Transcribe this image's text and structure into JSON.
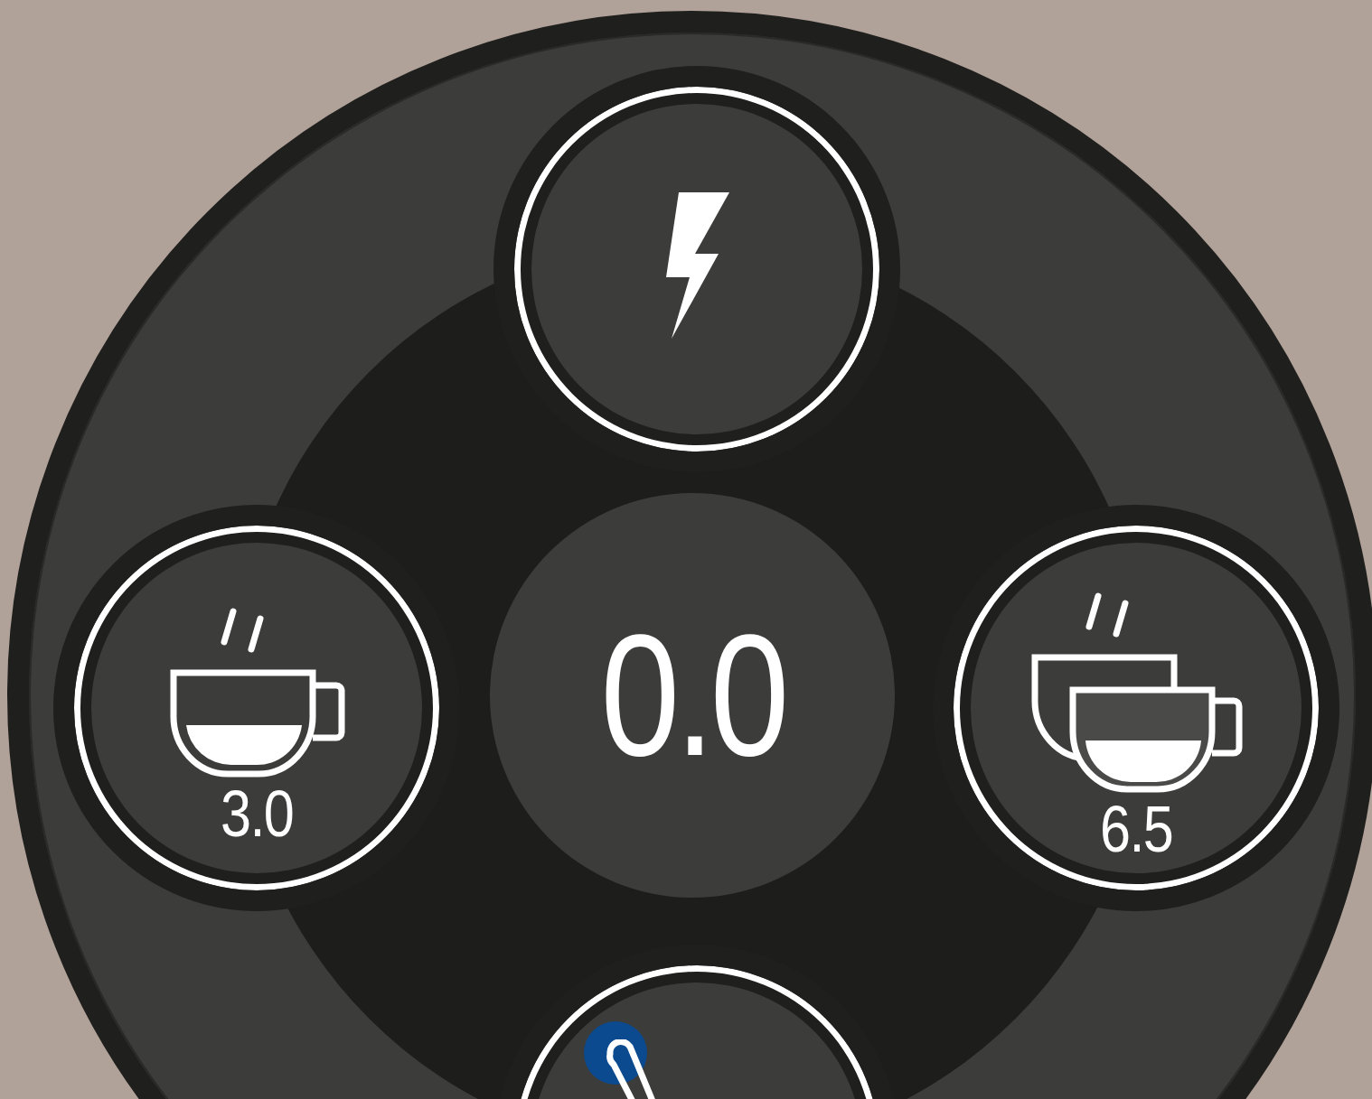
{
  "display": {
    "value": "0.0"
  },
  "buttons": [
    {
      "kind": "lightning",
      "alert": false
    },
    {
      "kind": "single-cup",
      "label": "3.0",
      "alert": false
    },
    {
      "kind": "double-cup",
      "label": "6.5",
      "alert": false
    },
    {
      "kind": "wand",
      "alert": true
    }
  ]
}
